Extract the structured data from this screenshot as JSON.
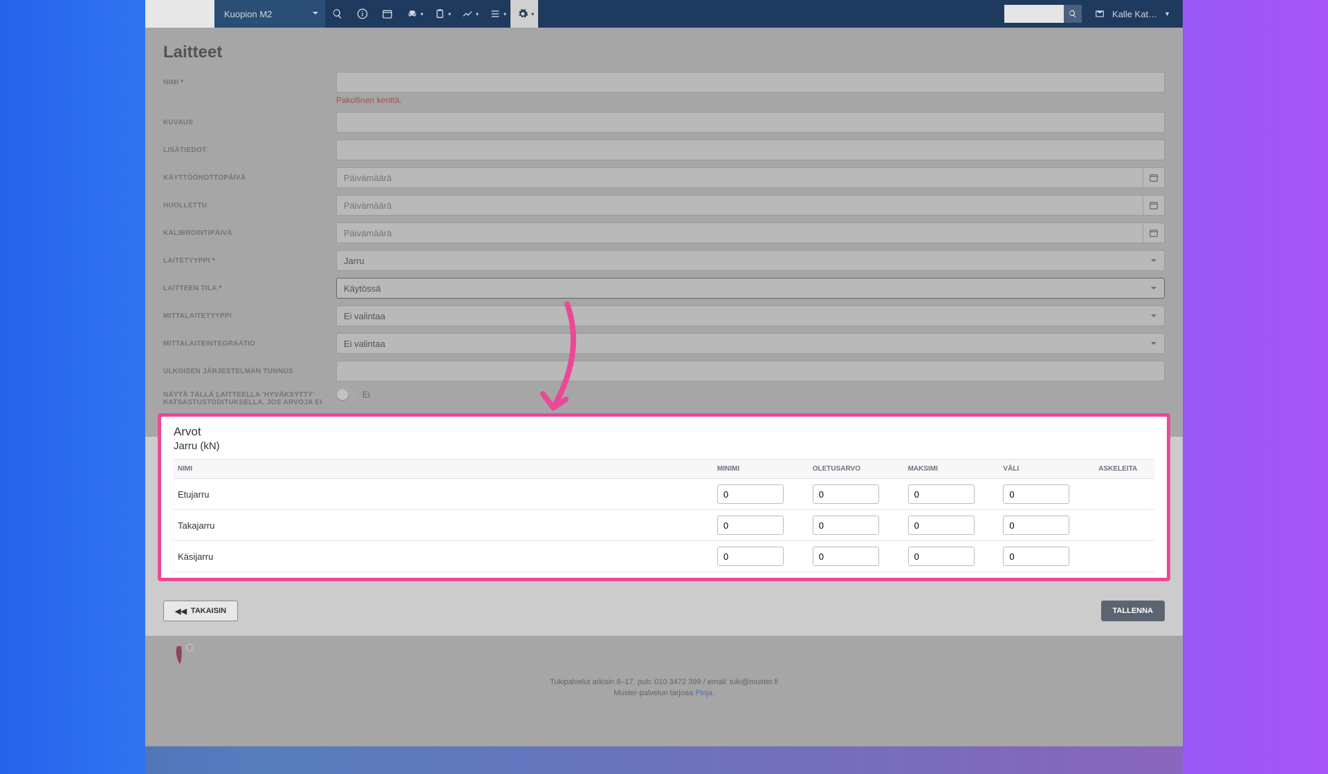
{
  "topbar": {
    "location": "Kuopion M2",
    "user": "Kalle Kat…"
  },
  "page": {
    "title": "Laitteet"
  },
  "labels": {
    "nimi": "NIMI",
    "kuvaus": "KUVAUS",
    "lisatiedot": "LISÄTIEDOT",
    "kayttoonotto": "KÄYTTÖÖNOTTOPÄIVÄ",
    "huollettu": "HUOLLETTU",
    "kalibrointi": "KALIBROINTIPÄIVÄ",
    "laitetyyppi": "LAITETYYPPI",
    "tila": "LAITTEEN TILA",
    "mittatyyppi": "MITTALAITETYYPPI",
    "integraatio": "MITTALAITEINTEGRAATIO",
    "ulkoinen": "ULKOISEN JÄRJESTELMÄN TUNNUS",
    "nayta": "NÄYTÄ TÄLLÄ LAITTEELLA 'HYVÄKSYTTY' KATSASTUSTODITUKSELLA, JOS ARVOJA EI"
  },
  "placeholders": {
    "paivamaara": "Päivämäärä"
  },
  "errors": {
    "required": "Pakollinen kenttä."
  },
  "selects": {
    "laitetyyppi": "Jarru",
    "tila": "Käytössä",
    "mittatyyppi": "Ei valintaa",
    "integraatio": "Ei valintaa"
  },
  "toggle": {
    "label": "Ei"
  },
  "arvot": {
    "title": "Arvot",
    "subtitle": "Jarru (kN)",
    "columns": {
      "nimi": "NIMI",
      "minimi": "MINIMI",
      "oletus": "OLETUSARVO",
      "maksimi": "MAKSIMI",
      "vali": "VÄLI",
      "askeleita": "ASKELEITA"
    },
    "rows": [
      {
        "name": "Etujarru",
        "min": "0",
        "def": "0",
        "max": "0",
        "gap": "0"
      },
      {
        "name": "Takajarru",
        "min": "0",
        "def": "0",
        "max": "0",
        "gap": "0"
      },
      {
        "name": "Käsijarru",
        "min": "0",
        "def": "0",
        "max": "0",
        "gap": "0"
      }
    ]
  },
  "buttons": {
    "back": "TAKAISIN",
    "save": "TALLENNA"
  },
  "footer": {
    "line1": "Tukipalvelut arkisin 8–17. puh: 010 3472 399 / email: tuki@muster.fi",
    "line2_a": "Muster-palvelun tarjoaa ",
    "line2_b": "Pinja"
  }
}
